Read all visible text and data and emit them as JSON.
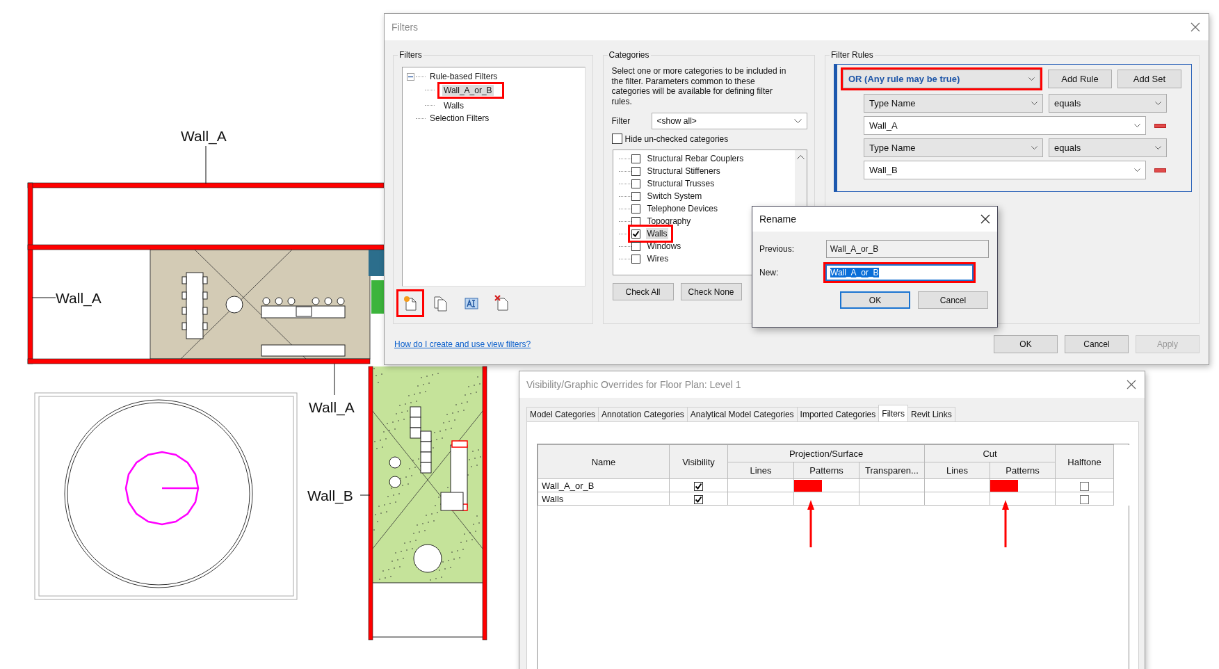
{
  "plan": {
    "tags": [
      {
        "text": "Wall_A"
      },
      {
        "text": "Wall_A"
      },
      {
        "text": "Wall_A"
      },
      {
        "text": "Wall_B"
      }
    ]
  },
  "filters_dialog": {
    "title": "Filters",
    "filters_group": {
      "label": "Filters",
      "tree": [
        {
          "label": "Rule-based Filters",
          "expanded": true,
          "children": [
            {
              "label": "Wall_A_or_B",
              "selected": true,
              "annotated": true
            },
            {
              "label": "Walls",
              "selected": false,
              "annotated": false
            }
          ]
        },
        {
          "label": "Selection Filters"
        }
      ],
      "tools": [
        {
          "kind": "new",
          "annotated": true
        },
        {
          "kind": "copy",
          "annotated": false
        },
        {
          "kind": "rename",
          "annotated": false
        },
        {
          "kind": "delete",
          "annotated": false
        }
      ]
    },
    "help_link": "How do I create and use view filters?",
    "categories": {
      "label": "Categories",
      "description": "Select one or more categories to be included in the filter.  Parameters common to these categories will be available for defining filter rules.",
      "filter_label": "Filter",
      "filter_value": "<show all>",
      "hide_unchecked": {
        "label": "Hide un-checked categories",
        "checked": false
      },
      "items": [
        {
          "label": "Structural Rebar Couplers",
          "checked": false,
          "selected": false,
          "annotated": false
        },
        {
          "label": "Structural Stiffeners",
          "checked": false,
          "selected": false,
          "annotated": false
        },
        {
          "label": "Structural Trusses",
          "checked": false,
          "selected": false,
          "annotated": false
        },
        {
          "label": "Switch System",
          "checked": false,
          "selected": false,
          "annotated": false
        },
        {
          "label": "Telephone Devices",
          "checked": false,
          "selected": false,
          "annotated": false
        },
        {
          "label": "Topography",
          "checked": false,
          "selected": false,
          "annotated": false
        },
        {
          "label": "Walls",
          "checked": true,
          "selected": true,
          "annotated": true
        },
        {
          "label": "Windows",
          "checked": false,
          "selected": false,
          "annotated": false
        },
        {
          "label": "Wires",
          "checked": false,
          "selected": false,
          "annotated": false
        }
      ],
      "buttons": [
        "Check All",
        "Check None"
      ]
    },
    "filter_rules": {
      "label": "Filter Rules",
      "logic": {
        "value": "OR (Any rule may be true)",
        "annotated": true
      },
      "buttons": [
        "Add Rule",
        "Add Set"
      ],
      "rules": [
        {
          "parameter": "Type Name",
          "operator": "equals",
          "value": "Wall_A"
        },
        {
          "parameter": "Type Name",
          "operator": "equals",
          "value": "Wall_B"
        }
      ]
    },
    "buttons": [
      {
        "label": "OK",
        "disabled": false
      },
      {
        "label": "Cancel",
        "disabled": false
      },
      {
        "label": "Apply",
        "disabled": true
      }
    ]
  },
  "rename_dialog": {
    "title": "Rename",
    "previous_label": "Previous:",
    "previous": "Wall_A_or_B",
    "new_label": "New:",
    "new": "Wall_A_or_B",
    "new_text_selected": true,
    "new_annotated": true,
    "buttons": [
      {
        "label": "OK",
        "default": true
      },
      {
        "label": "Cancel",
        "default": false
      }
    ]
  },
  "vg_dialog": {
    "title": "Visibility/Graphic Overrides for Floor Plan: Level 1",
    "tabs": [
      {
        "label": "Model Categories",
        "selected": false
      },
      {
        "label": "Annotation Categories",
        "selected": false
      },
      {
        "label": "Analytical Model Categories",
        "selected": false
      },
      {
        "label": "Imported Categories",
        "selected": false
      },
      {
        "label": "Filters",
        "selected": true
      },
      {
        "label": "Revit Links",
        "selected": false
      }
    ],
    "table": {
      "headers": {
        "name": "Name",
        "visibility": "Visibility",
        "projection": "Projection/Surface",
        "cut": "Cut",
        "halftone": "Halftone",
        "projection_sub": [
          "Lines",
          "Patterns",
          "Transparen..."
        ],
        "cut_sub": [
          "Lines",
          "Patterns"
        ]
      },
      "rows": [
        {
          "name": "Wall_A_or_B",
          "visible": true,
          "projection_pattern": {
            "color": "#ff0000"
          },
          "cut_pattern": {
            "color": "#ff0000"
          },
          "halftone": false
        },
        {
          "name": "Walls",
          "visible": true,
          "halftone": false
        }
      ]
    }
  }
}
